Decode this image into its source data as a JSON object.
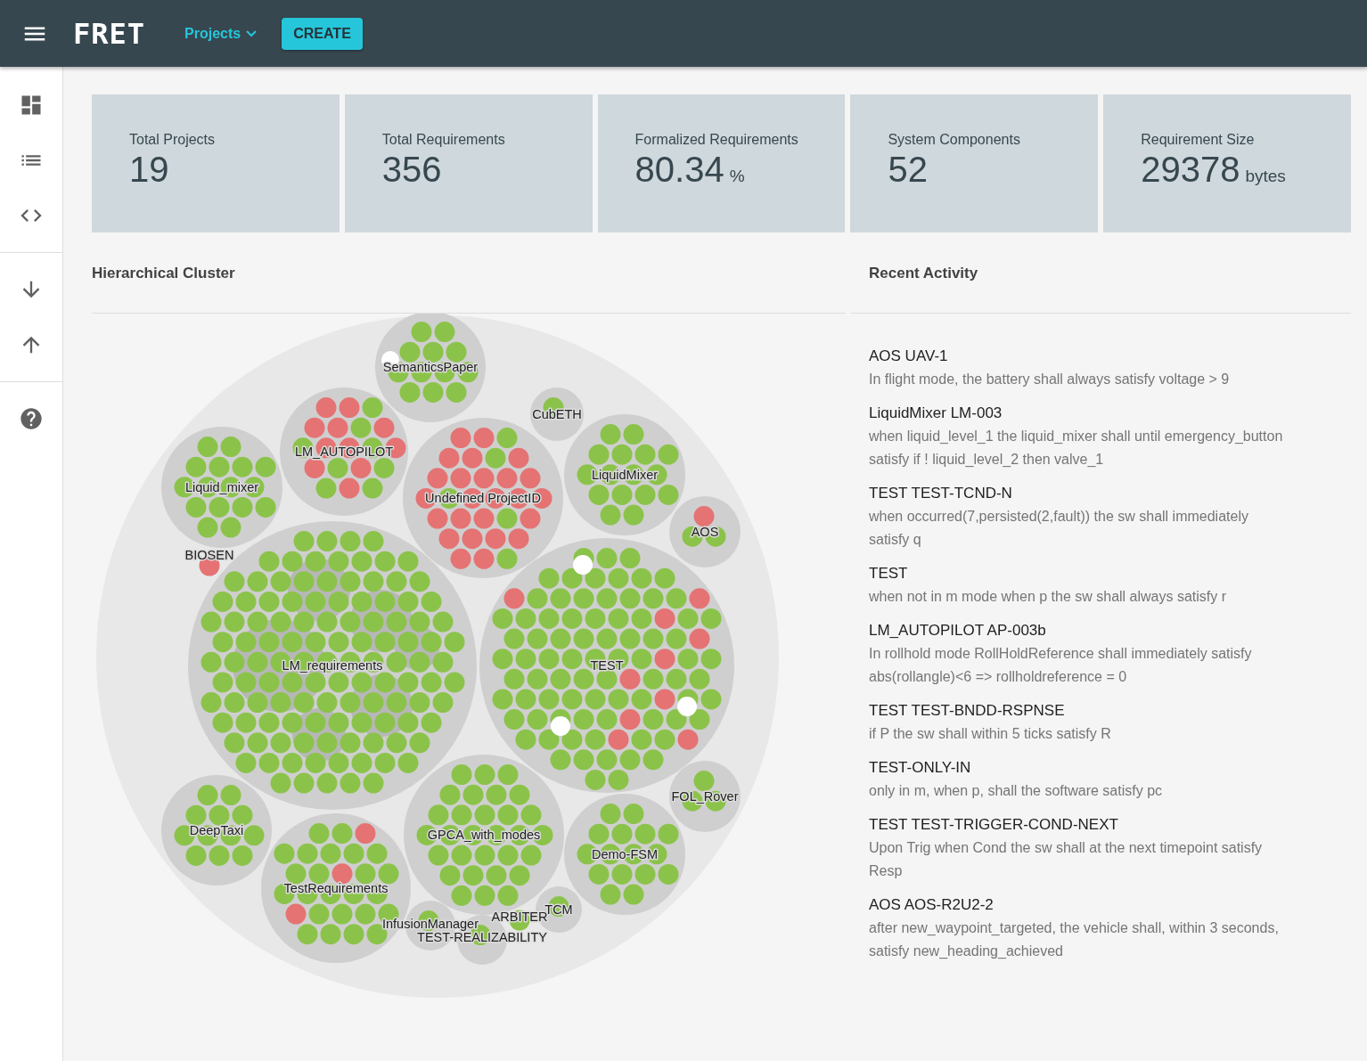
{
  "app_bar": {
    "logo": "FRET",
    "projects_menu": "Projects",
    "create_button": "CREATE"
  },
  "sidebar": {
    "items": [
      {
        "kind": "dashboard"
      },
      {
        "kind": "list"
      },
      {
        "kind": "code"
      },
      {
        "kind": "divider"
      },
      {
        "kind": "download"
      },
      {
        "kind": "upload"
      },
      {
        "kind": "divider"
      },
      {
        "kind": "help"
      }
    ]
  },
  "stats": [
    {
      "label": "Total Projects",
      "value": "19"
    },
    {
      "label": "Total Requirements",
      "value": "356"
    },
    {
      "label": "Formalized Requirements",
      "value": "80.34",
      "unit": "%"
    },
    {
      "label": "System Components",
      "value": "52"
    },
    {
      "label": "Requirement Size",
      "value": "29378",
      "unit": "bytes"
    }
  ],
  "cluster": {
    "title": "Hierarchical Cluster",
    "projects": [
      {
        "label": "SemanticsPaper"
      },
      {
        "label": "CubETH"
      },
      {
        "label": "LM_AUTOPILOT"
      },
      {
        "label": "Liquid_mixer"
      },
      {
        "label": "Undefined ProjectID"
      },
      {
        "label": "LiquidMixer"
      },
      {
        "label": "AOS"
      },
      {
        "label": "BIOSEN"
      },
      {
        "label": "LM_requirements"
      },
      {
        "label": "TEST"
      },
      {
        "label": "FOL_Rover"
      },
      {
        "label": "DeepTaxi"
      },
      {
        "label": "TestRequirements"
      },
      {
        "label": "GPCA_with_modes"
      },
      {
        "label": "Demo-FSM"
      },
      {
        "label": "TCM"
      },
      {
        "label": "ARBITER"
      },
      {
        "label": "InfusionManager"
      },
      {
        "label": "TEST-REALIZABILITY"
      }
    ]
  },
  "recent_activity": {
    "title": "Recent Activity",
    "items": [
      {
        "title": "AOS UAV-1",
        "text": "In flight mode, the battery shall always satisfy voltage > 9"
      },
      {
        "title": "LiquidMixer LM-003",
        "text": "when liquid_level_1 the liquid_mixer shall until emergency_button satisfy if ! liquid_level_2 then valve_1"
      },
      {
        "title": "TEST TEST-TCND-N",
        "text": "when occurred(7,persisted(2,fault)) the sw shall immediately satisfy q"
      },
      {
        "title": "TEST",
        "text": "when not in m mode when p the sw shall always satisfy r"
      },
      {
        "title": "LM_AUTOPILOT AP-003b",
        "text": "In rollhold mode RollHoldReference shall immediately satisfy abs(rollangle)<6 => rollholdreference = 0"
      },
      {
        "title": "TEST TEST-BNDD-RSPNSE",
        "text": "if P the sw shall within 5 ticks satisfy R"
      },
      {
        "title": "TEST-ONLY-IN",
        "text": "only in m, when p, shall the software satisfy pc"
      },
      {
        "title": "TEST TEST-TRIGGER-COND-NEXT",
        "text": "Upon Trig when Cond the sw shall at the next timepoint satisfy Resp"
      },
      {
        "title": "AOS AOS-R2U2-2",
        "text": "after new_waypoint_targeted, the vehicle shall, within 3 seconds, satisfy new_heading_achieved"
      }
    ]
  }
}
